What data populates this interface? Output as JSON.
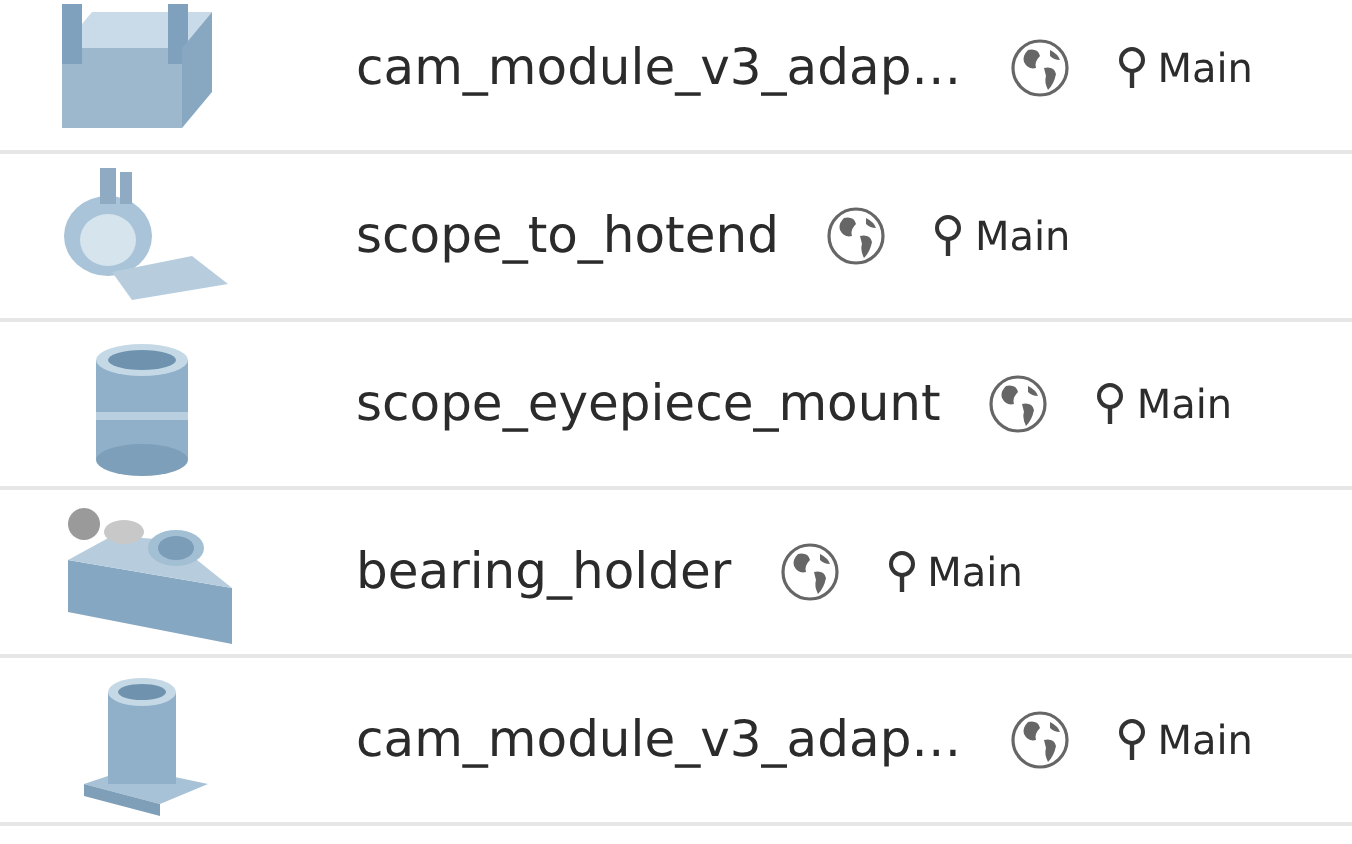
{
  "documents": [
    {
      "name": "cam_module_v3_adap…",
      "public": true,
      "branch": "Main"
    },
    {
      "name": "scope_to_hotend",
      "public": true,
      "branch": "Main"
    },
    {
      "name": "scope_eyepiece_mount",
      "public": true,
      "branch": "Main"
    },
    {
      "name": "bearing_holder",
      "public": true,
      "branch": "Main"
    },
    {
      "name": "cam_module_v3_adap…",
      "public": true,
      "branch": "Main"
    }
  ]
}
